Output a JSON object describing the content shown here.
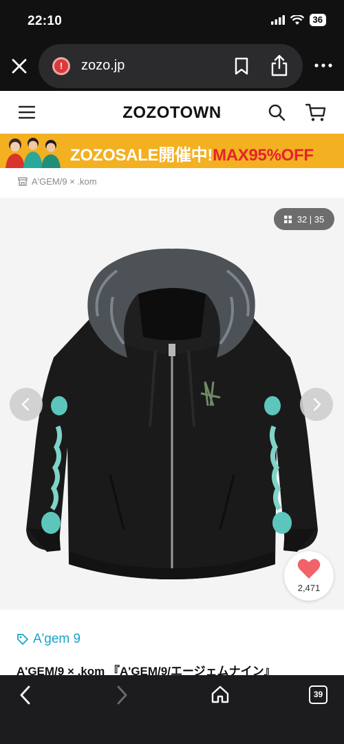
{
  "status_bar": {
    "time": "22:10",
    "battery": "36",
    "icons": [
      "signal-icon",
      "wifi-icon",
      "battery-icon"
    ]
  },
  "browser": {
    "url": "zozo.jp",
    "site_warning_icon": "!",
    "tab_count": "39"
  },
  "header": {
    "logo": "ZOZOTOWN"
  },
  "banner": {
    "sale_white": "ZOZOSALE開催中!",
    "sale_red": "MAX95%OFF"
  },
  "breadcrumb": {
    "shop": "A'GEM/9 × .kom"
  },
  "gallery": {
    "counter": "32 | 35",
    "favorites": "2,471"
  },
  "product": {
    "brand": "A'gem 9",
    "title": "A'GEM/9 × .kom 『A'GEM/9/エージェムナイン』"
  },
  "colors": {
    "chrome_dark": "#111111",
    "banner_yellow": "#f3b021",
    "sale_red": "#e5222c",
    "brand_blue": "#1aa3c8",
    "heart_pink": "#f0636a"
  }
}
